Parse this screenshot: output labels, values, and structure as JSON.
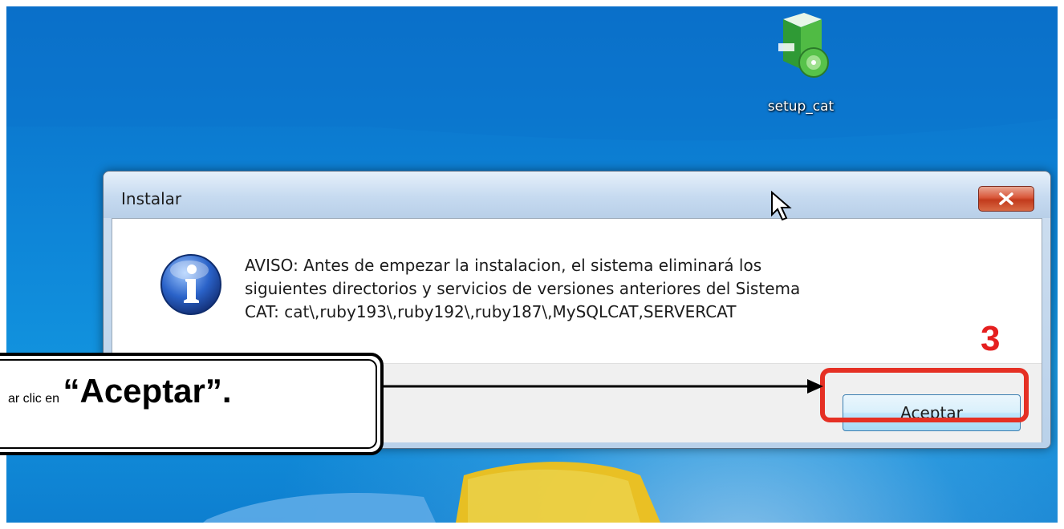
{
  "desktop": {
    "icon_label": "setup_cat",
    "icon_name": "installer-package-icon"
  },
  "dialog": {
    "title": "Instalar",
    "close_label": "close",
    "icon_name": "information-icon",
    "message_lines": [
      "AVISO: Antes de empezar la instalacion, el sistema eliminará los",
      "siguientes directorios y servicios de versiones anteriores del Sistema",
      "CAT: cat\\,ruby193\\,ruby192\\,ruby187\\,MySQLCAT,SERVERCAT"
    ],
    "ok_label": "Aceptar"
  },
  "annotation": {
    "step_number": "3",
    "instruction_prefix": "ar clic en",
    "instruction_emphasis": "“Aceptar”.",
    "highlight_color": "#e53024",
    "step_color": "#e51f1f"
  }
}
